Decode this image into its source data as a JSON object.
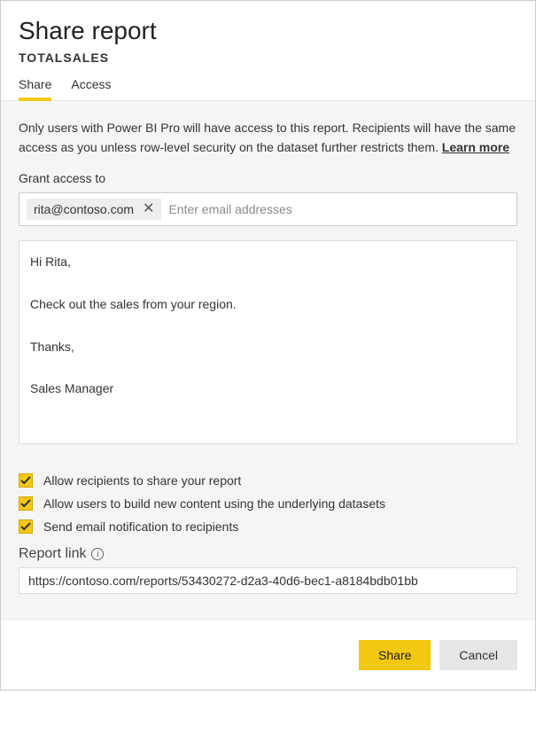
{
  "header": {
    "title": "Share report",
    "subtitle": "TOTALSALES"
  },
  "tabs": {
    "share": "Share",
    "access": "Access"
  },
  "info": {
    "text": "Only users with Power BI Pro will have access to this report. Recipients will have the same access as you unless row-level security on the dataset further restricts them.   ",
    "learn_more": "Learn more"
  },
  "grant": {
    "label": "Grant access to",
    "chip": "rita@contoso.com",
    "placeholder": "Enter email addresses"
  },
  "message": "Hi Rita,\n\nCheck out the sales from your region.\n\nThanks,\n\nSales Manager",
  "options": {
    "opt1": "Allow recipients to share your report",
    "opt2": "Allow users to build new content using the underlying datasets",
    "opt3": "Send email notification to recipients"
  },
  "report_link": {
    "label": "Report link",
    "value": "https://contoso.com/reports/53430272-d2a3-40d6-bec1-a8184bdb01bb"
  },
  "buttons": {
    "share": "Share",
    "cancel": "Cancel"
  }
}
